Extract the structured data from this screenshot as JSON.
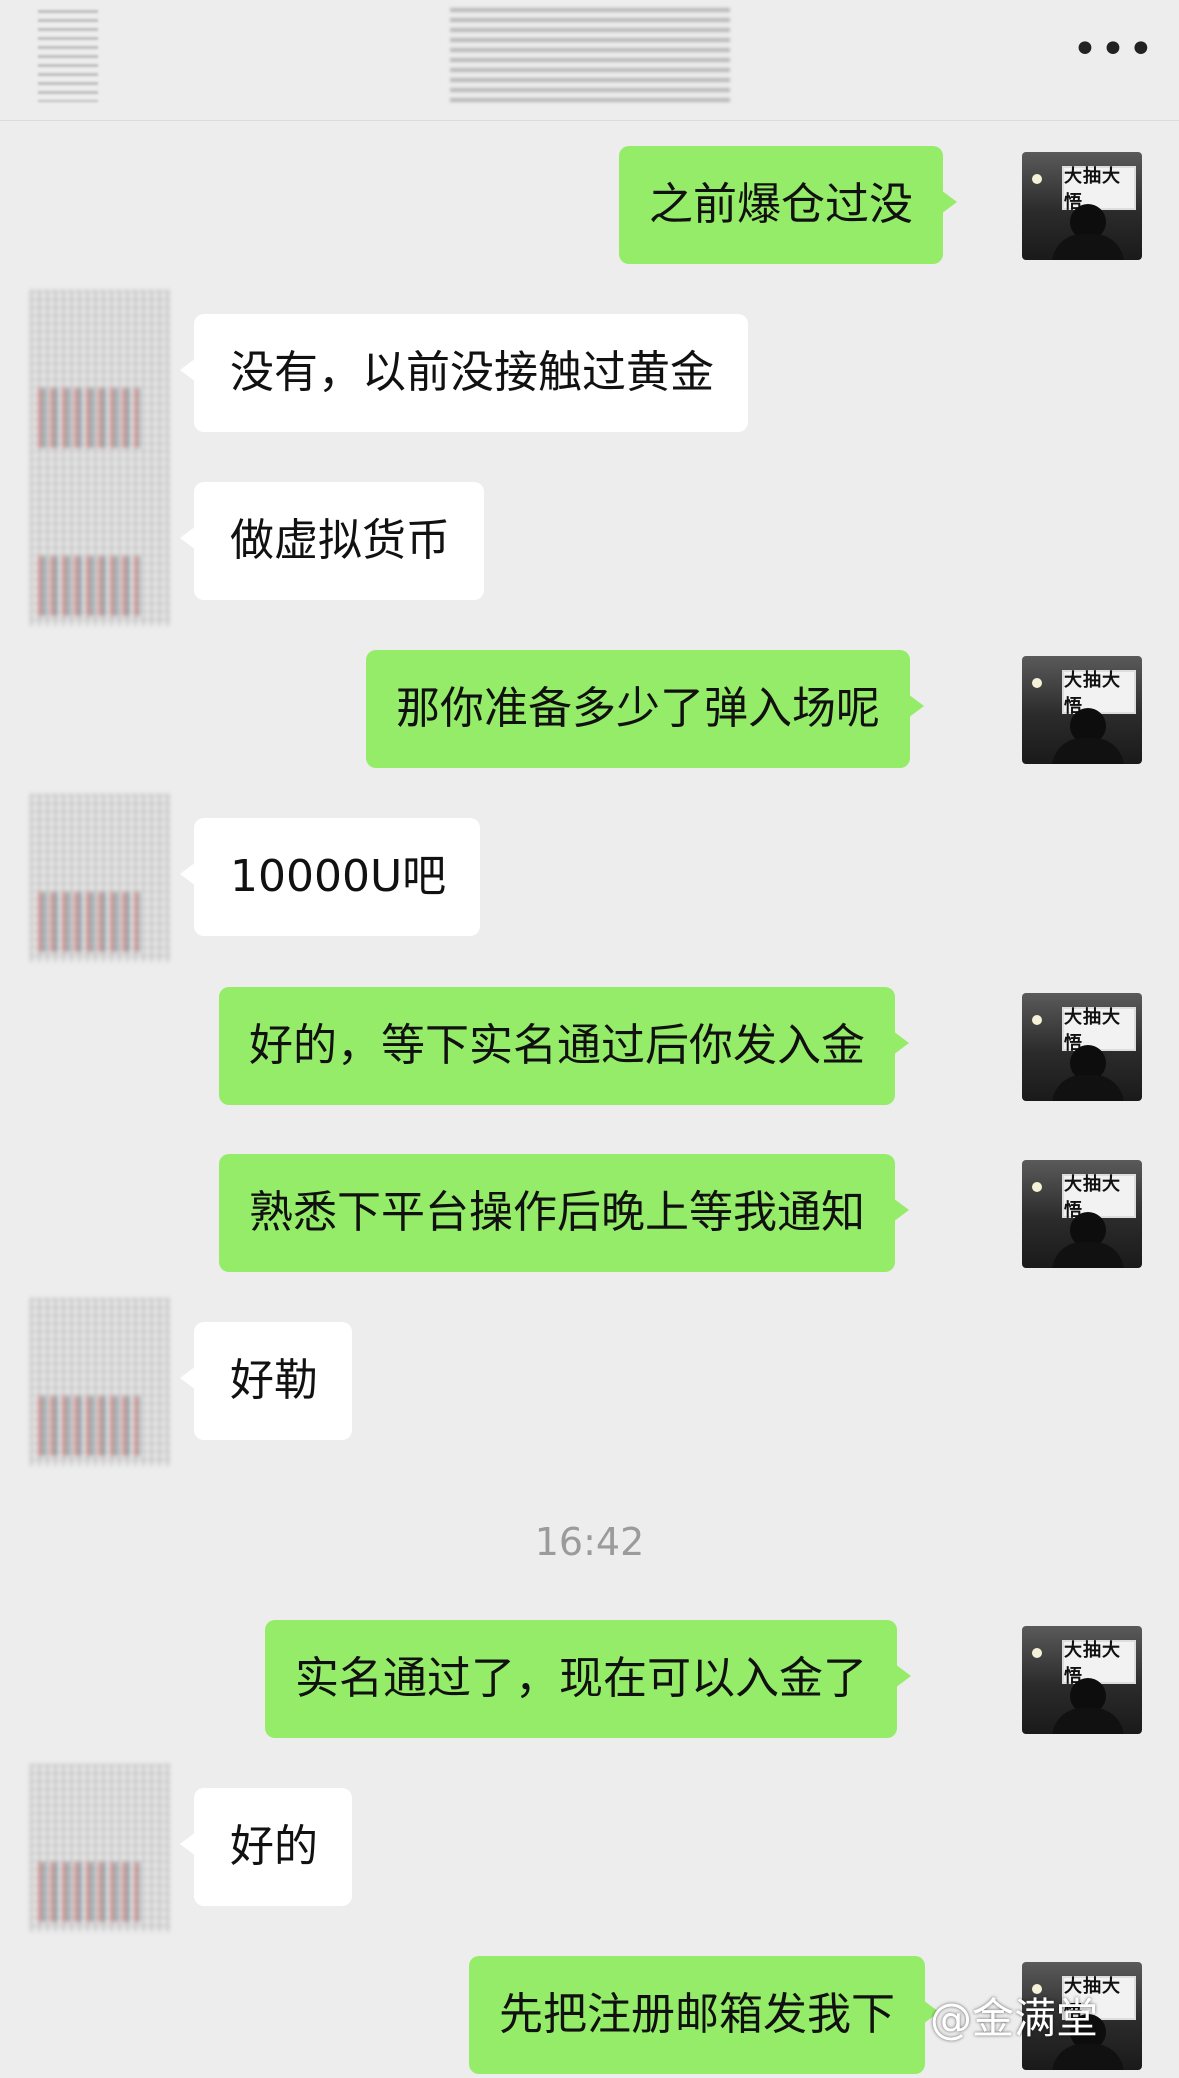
{
  "header": {
    "more_icon": "more-dots-icon",
    "more_label": "•••"
  },
  "messages": [
    {
      "side": "right",
      "text": "之前爆仓过没"
    },
    {
      "side": "left",
      "text": "没有，以前没接触过黄金"
    },
    {
      "side": "left",
      "text": "做虚拟货币"
    },
    {
      "side": "right",
      "text": "那你准备多少了弹入场呢"
    },
    {
      "side": "left",
      "text": "10000U吧"
    },
    {
      "side": "right",
      "text": "好的，等下实名通过后你发入金"
    },
    {
      "side": "right",
      "text": "熟悉下平台操作后晚上等我通知"
    },
    {
      "side": "left",
      "text": "好勒"
    },
    {
      "side": "right",
      "text": "实名通过了，现在可以入金了"
    },
    {
      "side": "left",
      "text": "好的"
    },
    {
      "side": "right",
      "text": "先把注册邮箱发我下"
    }
  ],
  "timestamp": "16:42",
  "avatar_sign": "大抽大悟",
  "watermark": "@金满堂",
  "colors": {
    "background": "#ededed",
    "green_bubble": "#95ec69",
    "white_bubble": "#ffffff"
  }
}
